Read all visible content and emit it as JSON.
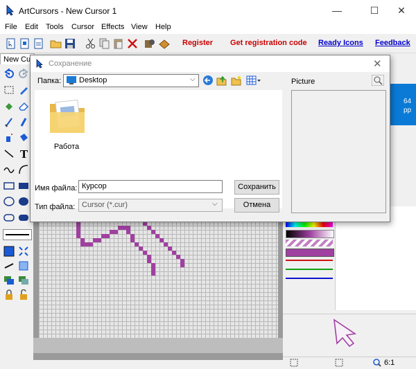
{
  "app": {
    "title": "ArtCursors - New Cursor 1"
  },
  "window_controls": {
    "minimize": "—",
    "maximize": "☐",
    "close": "✕"
  },
  "menu": [
    "File",
    "Edit",
    "Tools",
    "Cursor",
    "Effects",
    "View",
    "Help"
  ],
  "toolbar": {
    "links": [
      {
        "label": "Register",
        "color": "#cc0000",
        "underline": false
      },
      {
        "label": "Get registration code",
        "color": "#cc0000",
        "underline": false
      },
      {
        "label": "Ready Icons",
        "color": "#0000cc",
        "underline": true
      },
      {
        "label": "Feedback",
        "color": "#0000cc",
        "underline": true
      }
    ]
  },
  "document_tab": {
    "label": "New Cu"
  },
  "right_panel": {
    "blue_text_1": "64",
    "blue_text_2": "pp"
  },
  "status": {
    "zoom": "6:1"
  },
  "dialog": {
    "title": "Сохранение",
    "folder_label": "Папка:",
    "folder_value": "Desktop",
    "items": [
      {
        "name": "Работа"
      }
    ],
    "picture_label": "Picture",
    "filename_label": "Имя файла:",
    "filename_value": "Курсор",
    "filetype_label": "Тип файла:",
    "filetype_value": "Cursor (*.cur)",
    "save_button": "Сохранить",
    "cancel_button": "Отмена"
  },
  "colors": {
    "accent_blue": "#0a7ad6",
    "cursor_purple": "#a040a0"
  }
}
